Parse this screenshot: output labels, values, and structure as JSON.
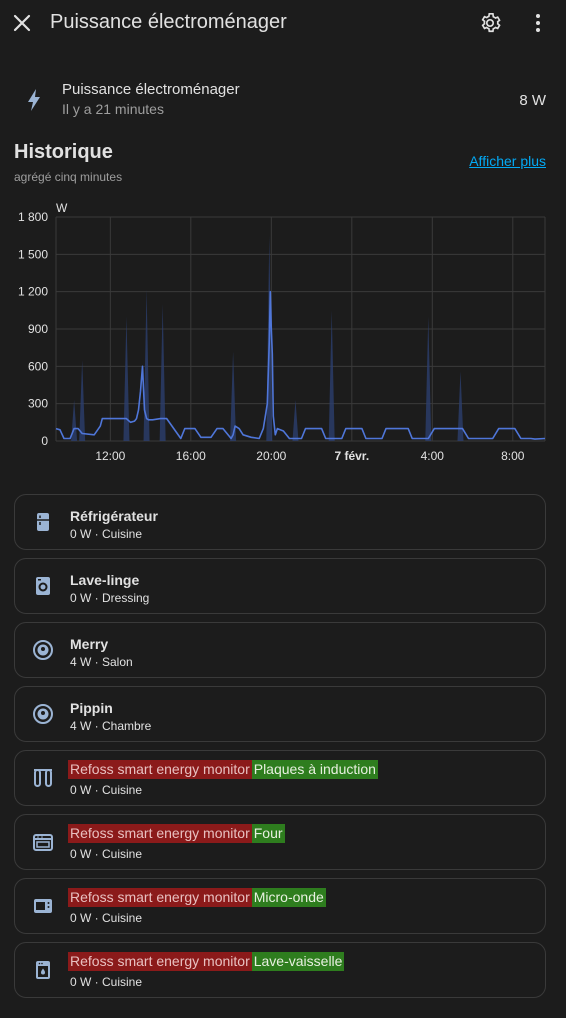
{
  "header": {
    "title": "Puissance électroménager",
    "close_icon": "close-icon",
    "settings_icon": "gear-icon",
    "more_icon": "more-vertical-icon"
  },
  "state": {
    "name": "Puissance électroménager",
    "last_changed": "Il y a 21 minutes",
    "value": "8 W",
    "icon": "lightning-icon"
  },
  "history": {
    "title": "Historique",
    "subtitle": "agrégé cinq minutes",
    "show_more": "Afficher plus"
  },
  "chart_data": {
    "type": "line",
    "ylabel": "W",
    "ylim": [
      0,
      1800
    ],
    "y_ticks": [
      "1 800",
      "1 500",
      "1 200",
      "900",
      "600",
      "300",
      "0"
    ],
    "x_ticks": [
      "12:00",
      "16:00",
      "20:00",
      "7 févr.",
      "4:00",
      "8:00"
    ],
    "x_start_hour": 9.3,
    "x_end_hour": 33.6,
    "line_color": "#4f76d9",
    "series": [
      {
        "values_x_hours": [
          9.3,
          9.5,
          9.7,
          10.0,
          10.2,
          10.4,
          10.6,
          11.2,
          11.5,
          11.6,
          11.8,
          12.0,
          12.8,
          13.0,
          13.2,
          13.3,
          13.4,
          13.5,
          13.6,
          13.7,
          13.8,
          13.9,
          14.1,
          14.5,
          14.8,
          15.5,
          15.7,
          16.2,
          16.5,
          17.0,
          17.3,
          17.6,
          18.0,
          18.1,
          18.2,
          18.4,
          18.6,
          19.0,
          19.4,
          19.6,
          19.8,
          19.9,
          19.95,
          20.0,
          20.05,
          20.1,
          20.2,
          20.3,
          20.6,
          20.9,
          21.5,
          21.7,
          22.5,
          22.7,
          23.5,
          23.7,
          24.5,
          24.7,
          25.5,
          25.7,
          26.8,
          27.0,
          27.8,
          28.1,
          29.5,
          29.8,
          31.0,
          31.3,
          32.1,
          32.4,
          32.9,
          33.1,
          33.6
        ],
        "values_y": [
          100,
          90,
          20,
          20,
          100,
          100,
          60,
          50,
          120,
          180,
          180,
          180,
          180,
          150,
          160,
          180,
          250,
          400,
          600,
          250,
          180,
          170,
          170,
          180,
          180,
          20,
          100,
          100,
          30,
          30,
          100,
          100,
          20,
          50,
          120,
          100,
          50,
          30,
          20,
          100,
          300,
          800,
          1200,
          900,
          700,
          200,
          50,
          100,
          80,
          20,
          20,
          100,
          100,
          20,
          20,
          100,
          100,
          20,
          20,
          100,
          100,
          20,
          20,
          100,
          100,
          20,
          20,
          100,
          100,
          20,
          20,
          15,
          20
        ]
      }
    ]
  },
  "devices": [
    {
      "icon": "fridge-icon",
      "name": "Réfrigérateur",
      "secondary": "0 W · Cuisine"
    },
    {
      "icon": "washing-machine-icon",
      "name": "Lave-linge",
      "secondary": "0 W · Dressing"
    },
    {
      "icon": "robot-vacuum-icon",
      "name": "Merry",
      "secondary": "4 W · Salon"
    },
    {
      "icon": "robot-vacuum-icon",
      "name": "Pippin",
      "secondary": "4 W · Chambre"
    },
    {
      "icon": "induction-hob-icon",
      "name_prefix": "Refoss smart energy monitor",
      "name_suffix": "Plaques à induction",
      "secondary": "0 W · Cuisine"
    },
    {
      "icon": "oven-icon",
      "name_prefix": "Refoss smart energy monitor",
      "name_suffix": "Four",
      "secondary": "0 W · Cuisine"
    },
    {
      "icon": "microwave-icon",
      "name_prefix": "Refoss smart energy monitor",
      "name_suffix": "Micro-onde",
      "secondary": "0 W · Cuisine"
    },
    {
      "icon": "dishwasher-icon",
      "name_prefix": "Refoss smart energy monitor",
      "name_suffix": "Lave-vaisselle",
      "secondary": "0 W · Cuisine"
    }
  ]
}
